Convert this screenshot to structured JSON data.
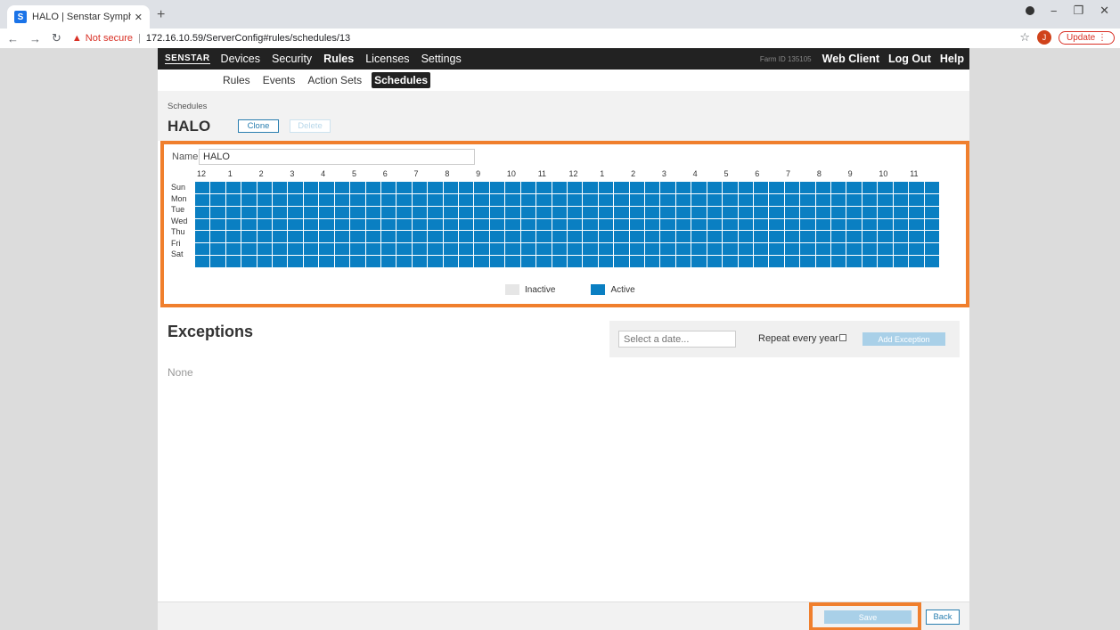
{
  "browser": {
    "tab_title": "HALO | Senstar Symphony Serve",
    "tab_favicon": "S",
    "new_tab": "+",
    "url": "172.16.10.59/ServerConfig#rules/schedules/13",
    "security_label": "Not secure",
    "profile_initial": "J",
    "update_label": "Update"
  },
  "topnav": {
    "logo": "SENSTAR",
    "items": [
      "Devices",
      "Security",
      "Rules",
      "Licenses",
      "Settings"
    ],
    "active": "Rules",
    "farm_id": "Farm ID 135105",
    "right_items": [
      "Web Client",
      "Log Out",
      "Help"
    ]
  },
  "subnav": {
    "items": [
      "Rules",
      "Events",
      "Action Sets",
      "Schedules"
    ],
    "active": "Schedules"
  },
  "header": {
    "breadcrumb": "Schedules",
    "title": "HALO",
    "clone_label": "Clone",
    "delete_label": "Delete"
  },
  "schedule": {
    "name_label": "Name",
    "name_value": "HALO",
    "hours": [
      "12",
      "1",
      "2",
      "3",
      "4",
      "5",
      "6",
      "7",
      "8",
      "9",
      "10",
      "11",
      "12",
      "1",
      "2",
      "3",
      "4",
      "5",
      "6",
      "7",
      "8",
      "9",
      "10",
      "11"
    ],
    "days": [
      "Sun",
      "Mon",
      "Tue",
      "Wed",
      "Thu",
      "Fri",
      "Sat"
    ],
    "slots_per_day": 48,
    "all_active": true,
    "legend_inactive": "Inactive",
    "legend_active": "Active",
    "colors": {
      "active": "#0a7fc2",
      "inactive": "#e6e6e6",
      "highlight": "#f07f2d"
    }
  },
  "exceptions": {
    "title": "Exceptions",
    "date_placeholder": "Select a date...",
    "repeat_label": "Repeat every year",
    "add_label": "Add Exception",
    "empty_text": "None"
  },
  "footer": {
    "save_label": "Save",
    "back_label": "Back"
  }
}
